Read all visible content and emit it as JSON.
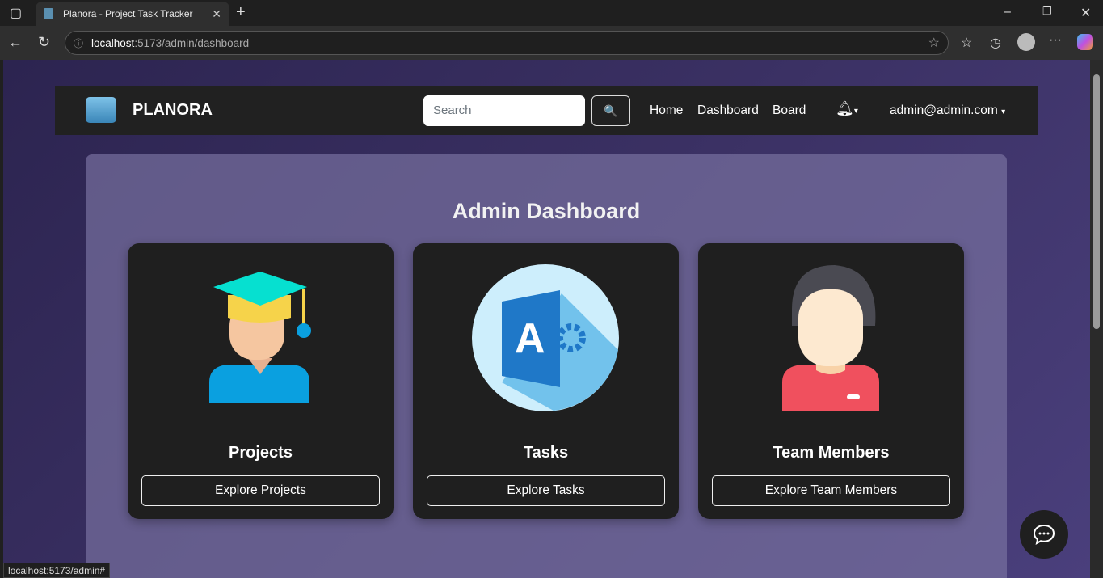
{
  "browser": {
    "tab_title": "Planora - Project Task Tracker",
    "url_host": "localhost",
    "url_path": ":5173/admin/dashboard",
    "status_url": "localhost:5173/admin#"
  },
  "navbar": {
    "brand": "PLANORA",
    "search_placeholder": "Search",
    "links": [
      "Home",
      "Dashboard",
      "Board"
    ],
    "user": "admin@admin.com"
  },
  "main": {
    "title": "Admin Dashboard",
    "cards": [
      {
        "title": "Projects",
        "button": "Explore Projects",
        "icon": "graduate-icon"
      },
      {
        "title": "Tasks",
        "button": "Explore Tasks",
        "icon": "access-app-icon"
      },
      {
        "title": "Team Members",
        "button": "Explore Team Members",
        "icon": "user-avatar-icon"
      }
    ]
  },
  "colors": {
    "card": "#1f1f1f",
    "navbar": "#212121"
  }
}
